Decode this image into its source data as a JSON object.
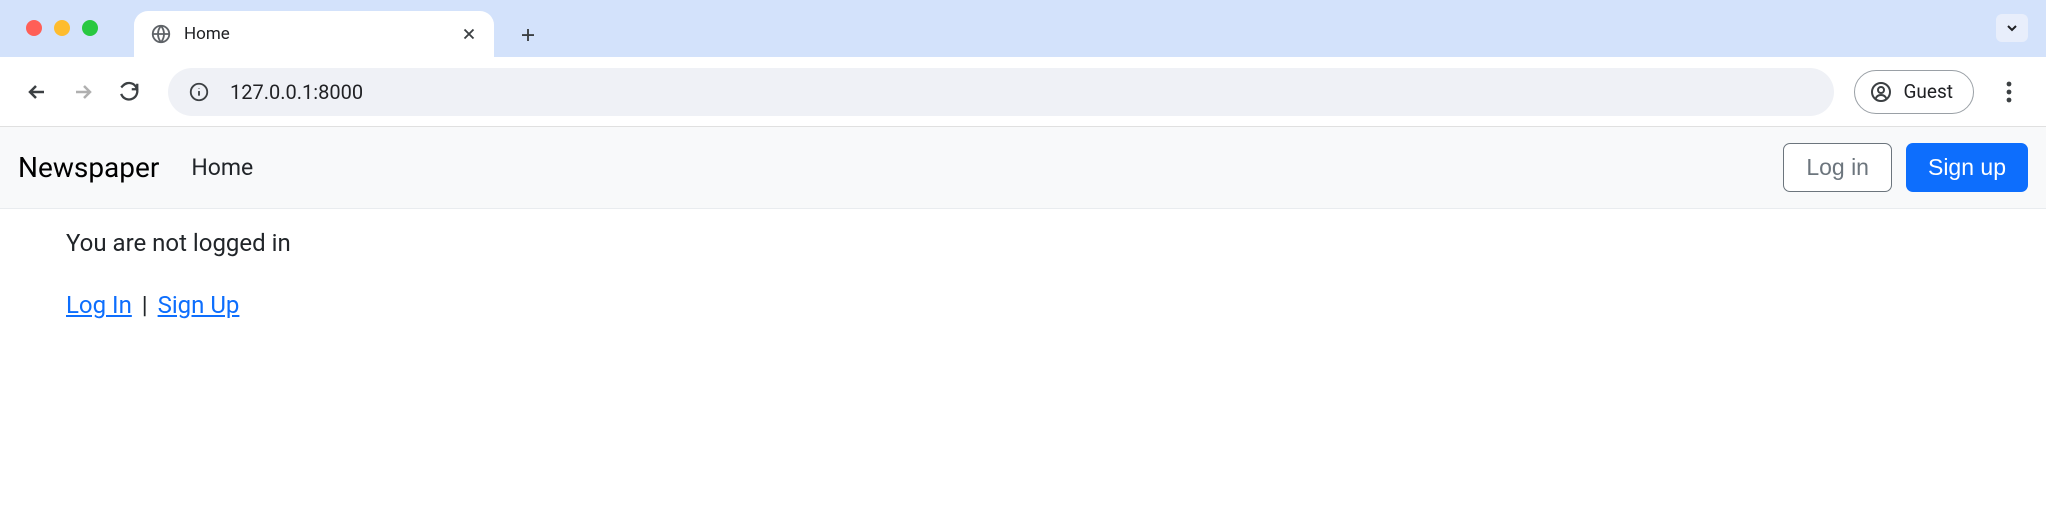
{
  "browser": {
    "tab_title": "Home",
    "url": "127.0.0.1:8000",
    "profile_label": "Guest"
  },
  "navbar": {
    "brand": "Newspaper",
    "home_link": "Home",
    "login_btn": "Log in",
    "signup_btn": "Sign up"
  },
  "content": {
    "status": "You are not logged in",
    "login_link": "Log In",
    "separator": "|",
    "signup_link": "Sign Up"
  }
}
